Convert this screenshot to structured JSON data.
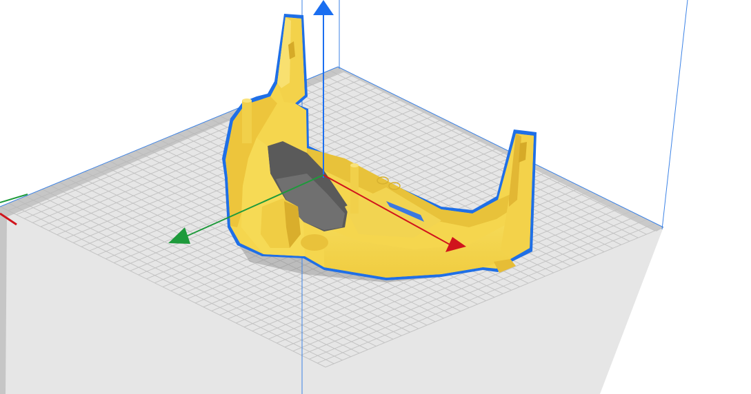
{
  "viewport": {
    "type": "3d-print-preparation-view",
    "object_selected": true,
    "axes": {
      "x": {
        "color": "#d0141c"
      },
      "y": {
        "color": "#1e9a3b"
      },
      "z": {
        "color": "#1a6ef0"
      }
    },
    "colors": {
      "background": "#ffffff",
      "build_plate": "#e6e6e6",
      "grid_lines": "#c3c3c3",
      "plate_border": "#b4b4b4",
      "volume_edges": "#3b82e6",
      "model": "#f5d64e",
      "model_shade": "#e7be32",
      "model_dark": "#c89c1d",
      "selection_outline": "#1f6fe6"
    },
    "icons": [
      "x-axis-arrow-icon",
      "y-axis-arrow-icon",
      "z-axis-arrow-icon"
    ]
  }
}
